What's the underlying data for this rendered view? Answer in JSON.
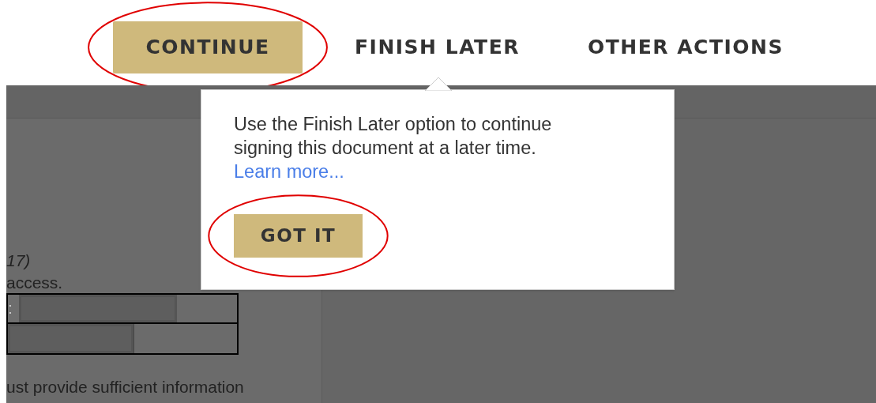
{
  "toolbar": [
    {
      "label": "CONTINUE",
      "kind": "primary",
      "circled": true
    },
    {
      "label": "FINISH LATER",
      "kind": "link",
      "circled": false
    },
    {
      "label": "OTHER ACTIONS",
      "kind": "link",
      "circled": false
    }
  ],
  "popover": {
    "text": "Use the Finish Later option to continue signing this document at a later time.",
    "link": "Learn more...",
    "button": {
      "label": "GOT IT",
      "circled": true
    }
  },
  "document": {
    "line_1": "17)",
    "line_2": "access.",
    "field_label": ":",
    "line_3": "ust provide sufficient information"
  }
}
